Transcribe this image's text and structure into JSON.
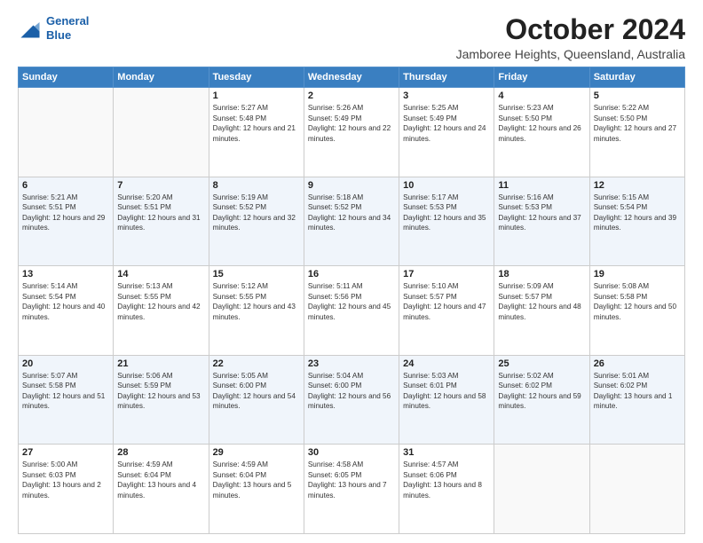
{
  "logo": {
    "line1": "General",
    "line2": "Blue"
  },
  "title": "October 2024",
  "subtitle": "Jamboree Heights, Queensland, Australia",
  "weekdays": [
    "Sunday",
    "Monday",
    "Tuesday",
    "Wednesday",
    "Thursday",
    "Friday",
    "Saturday"
  ],
  "weeks": [
    [
      {
        "day": "",
        "sunrise": "",
        "sunset": "",
        "daylight": ""
      },
      {
        "day": "",
        "sunrise": "",
        "sunset": "",
        "daylight": ""
      },
      {
        "day": "1",
        "sunrise": "Sunrise: 5:27 AM",
        "sunset": "Sunset: 5:48 PM",
        "daylight": "Daylight: 12 hours and 21 minutes."
      },
      {
        "day": "2",
        "sunrise": "Sunrise: 5:26 AM",
        "sunset": "Sunset: 5:49 PM",
        "daylight": "Daylight: 12 hours and 22 minutes."
      },
      {
        "day": "3",
        "sunrise": "Sunrise: 5:25 AM",
        "sunset": "Sunset: 5:49 PM",
        "daylight": "Daylight: 12 hours and 24 minutes."
      },
      {
        "day": "4",
        "sunrise": "Sunrise: 5:23 AM",
        "sunset": "Sunset: 5:50 PM",
        "daylight": "Daylight: 12 hours and 26 minutes."
      },
      {
        "day": "5",
        "sunrise": "Sunrise: 5:22 AM",
        "sunset": "Sunset: 5:50 PM",
        "daylight": "Daylight: 12 hours and 27 minutes."
      }
    ],
    [
      {
        "day": "6",
        "sunrise": "Sunrise: 5:21 AM",
        "sunset": "Sunset: 5:51 PM",
        "daylight": "Daylight: 12 hours and 29 minutes."
      },
      {
        "day": "7",
        "sunrise": "Sunrise: 5:20 AM",
        "sunset": "Sunset: 5:51 PM",
        "daylight": "Daylight: 12 hours and 31 minutes."
      },
      {
        "day": "8",
        "sunrise": "Sunrise: 5:19 AM",
        "sunset": "Sunset: 5:52 PM",
        "daylight": "Daylight: 12 hours and 32 minutes."
      },
      {
        "day": "9",
        "sunrise": "Sunrise: 5:18 AM",
        "sunset": "Sunset: 5:52 PM",
        "daylight": "Daylight: 12 hours and 34 minutes."
      },
      {
        "day": "10",
        "sunrise": "Sunrise: 5:17 AM",
        "sunset": "Sunset: 5:53 PM",
        "daylight": "Daylight: 12 hours and 35 minutes."
      },
      {
        "day": "11",
        "sunrise": "Sunrise: 5:16 AM",
        "sunset": "Sunset: 5:53 PM",
        "daylight": "Daylight: 12 hours and 37 minutes."
      },
      {
        "day": "12",
        "sunrise": "Sunrise: 5:15 AM",
        "sunset": "Sunset: 5:54 PM",
        "daylight": "Daylight: 12 hours and 39 minutes."
      }
    ],
    [
      {
        "day": "13",
        "sunrise": "Sunrise: 5:14 AM",
        "sunset": "Sunset: 5:54 PM",
        "daylight": "Daylight: 12 hours and 40 minutes."
      },
      {
        "day": "14",
        "sunrise": "Sunrise: 5:13 AM",
        "sunset": "Sunset: 5:55 PM",
        "daylight": "Daylight: 12 hours and 42 minutes."
      },
      {
        "day": "15",
        "sunrise": "Sunrise: 5:12 AM",
        "sunset": "Sunset: 5:55 PM",
        "daylight": "Daylight: 12 hours and 43 minutes."
      },
      {
        "day": "16",
        "sunrise": "Sunrise: 5:11 AM",
        "sunset": "Sunset: 5:56 PM",
        "daylight": "Daylight: 12 hours and 45 minutes."
      },
      {
        "day": "17",
        "sunrise": "Sunrise: 5:10 AM",
        "sunset": "Sunset: 5:57 PM",
        "daylight": "Daylight: 12 hours and 47 minutes."
      },
      {
        "day": "18",
        "sunrise": "Sunrise: 5:09 AM",
        "sunset": "Sunset: 5:57 PM",
        "daylight": "Daylight: 12 hours and 48 minutes."
      },
      {
        "day": "19",
        "sunrise": "Sunrise: 5:08 AM",
        "sunset": "Sunset: 5:58 PM",
        "daylight": "Daylight: 12 hours and 50 minutes."
      }
    ],
    [
      {
        "day": "20",
        "sunrise": "Sunrise: 5:07 AM",
        "sunset": "Sunset: 5:58 PM",
        "daylight": "Daylight: 12 hours and 51 minutes."
      },
      {
        "day": "21",
        "sunrise": "Sunrise: 5:06 AM",
        "sunset": "Sunset: 5:59 PM",
        "daylight": "Daylight: 12 hours and 53 minutes."
      },
      {
        "day": "22",
        "sunrise": "Sunrise: 5:05 AM",
        "sunset": "Sunset: 6:00 PM",
        "daylight": "Daylight: 12 hours and 54 minutes."
      },
      {
        "day": "23",
        "sunrise": "Sunrise: 5:04 AM",
        "sunset": "Sunset: 6:00 PM",
        "daylight": "Daylight: 12 hours and 56 minutes."
      },
      {
        "day": "24",
        "sunrise": "Sunrise: 5:03 AM",
        "sunset": "Sunset: 6:01 PM",
        "daylight": "Daylight: 12 hours and 58 minutes."
      },
      {
        "day": "25",
        "sunrise": "Sunrise: 5:02 AM",
        "sunset": "Sunset: 6:02 PM",
        "daylight": "Daylight: 12 hours and 59 minutes."
      },
      {
        "day": "26",
        "sunrise": "Sunrise: 5:01 AM",
        "sunset": "Sunset: 6:02 PM",
        "daylight": "Daylight: 13 hours and 1 minute."
      }
    ],
    [
      {
        "day": "27",
        "sunrise": "Sunrise: 5:00 AM",
        "sunset": "Sunset: 6:03 PM",
        "daylight": "Daylight: 13 hours and 2 minutes."
      },
      {
        "day": "28",
        "sunrise": "Sunrise: 4:59 AM",
        "sunset": "Sunset: 6:04 PM",
        "daylight": "Daylight: 13 hours and 4 minutes."
      },
      {
        "day": "29",
        "sunrise": "Sunrise: 4:59 AM",
        "sunset": "Sunset: 6:04 PM",
        "daylight": "Daylight: 13 hours and 5 minutes."
      },
      {
        "day": "30",
        "sunrise": "Sunrise: 4:58 AM",
        "sunset": "Sunset: 6:05 PM",
        "daylight": "Daylight: 13 hours and 7 minutes."
      },
      {
        "day": "31",
        "sunrise": "Sunrise: 4:57 AM",
        "sunset": "Sunset: 6:06 PM",
        "daylight": "Daylight: 13 hours and 8 minutes."
      },
      {
        "day": "",
        "sunrise": "",
        "sunset": "",
        "daylight": ""
      },
      {
        "day": "",
        "sunrise": "",
        "sunset": "",
        "daylight": ""
      }
    ]
  ]
}
